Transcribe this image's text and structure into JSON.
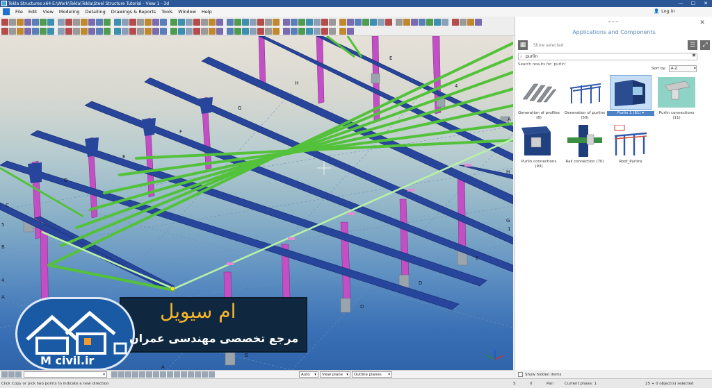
{
  "window": {
    "title": "Tekla Structures x64   E:\\Work\\Tekla\\Tekla\\Steel Structure Tutorial - View 1 - 3d",
    "minimize": "—",
    "maximize": "☐",
    "close": "✕"
  },
  "menu": [
    "File",
    "Edit",
    "View",
    "Modeling",
    "Detailing",
    "Drawings & Reports",
    "Tools",
    "Window",
    "Help"
  ],
  "login": "Log in",
  "viewport": {
    "labels": {
      "grid_a": "A",
      "grid_b": "B",
      "grid_c": "C",
      "grid_d": "D",
      "grid_e": "E",
      "grid_f": "F",
      "grid_g": "G",
      "grid_h": "H",
      "num_4": "4",
      "num_5": "5",
      "num_1": "1",
      "num_g": "G"
    }
  },
  "watermark": {
    "title": "ام سیویل",
    "subtitle": "مرجع تخصصی مهندسی عمران",
    "url": "M civil.ir"
  },
  "panel": {
    "title": "Applications and Components",
    "show_selected": "Show selected",
    "search_value": "purlin",
    "search_clear": "✖",
    "results_label": "Search results for 'purlin'",
    "sort_label": "Sort by",
    "sort_value": "A-Z",
    "tiles": [
      {
        "label": "Generation of profiles",
        "count": "(8)"
      },
      {
        "label": "Generation of purlins",
        "count": "(50)"
      },
      {
        "label": "Purlin 1 (61)",
        "count": ""
      },
      {
        "label": "Purlin connections",
        "count": "(11)"
      },
      {
        "label": "Purlin connections",
        "count": "(93)"
      },
      {
        "label": "Rail connection (70)",
        "count": ""
      },
      {
        "label": "Roof_Purlins",
        "count": ""
      }
    ],
    "show_hidden": "Show hidden items"
  },
  "viewbar": {
    "auto": "Auto",
    "view_plane": "View plane",
    "outline_planes": "Outline planes"
  },
  "status": {
    "prompt": "Click Copy or pick two points to indicate a new direction",
    "s": "S",
    "zero": "0",
    "pan": "Pan",
    "phase": "Current phase: 1",
    "selected": "25 + 0 object(s) selected"
  }
}
